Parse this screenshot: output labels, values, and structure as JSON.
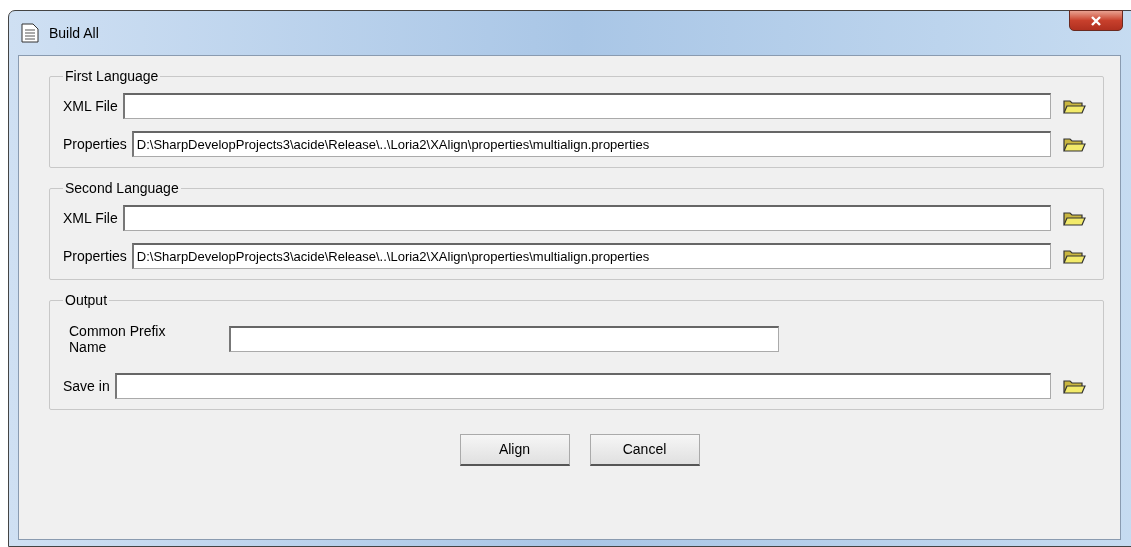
{
  "window": {
    "title": "Build All"
  },
  "groups": [
    {
      "title": "First Language",
      "fields": [
        {
          "kind": "path",
          "label": "XML File"
        },
        {
          "kind": "path",
          "label": "Properties",
          "value": "D:\\SharpDevelopProjects3\\acide\\Release\\..\\Loria2\\XAlign\\properties\\multialign.properties"
        }
      ]
    },
    {
      "title": "Second Language",
      "fields": [
        {
          "kind": "path",
          "label": "XML File"
        },
        {
          "kind": "path",
          "label": "Properties",
          "value": "D:\\SharpDevelopProjects3\\acide\\Release\\..\\Loria2\\XAlign\\properties\\multialign.properties"
        }
      ]
    },
    {
      "title": "Output",
      "fields": [
        {
          "kind": "name",
          "label": "Common Prefix Name"
        },
        {
          "kind": "path",
          "label": "Save in"
        }
      ]
    }
  ],
  "buttons": [
    "Align",
    "Cancel"
  ]
}
